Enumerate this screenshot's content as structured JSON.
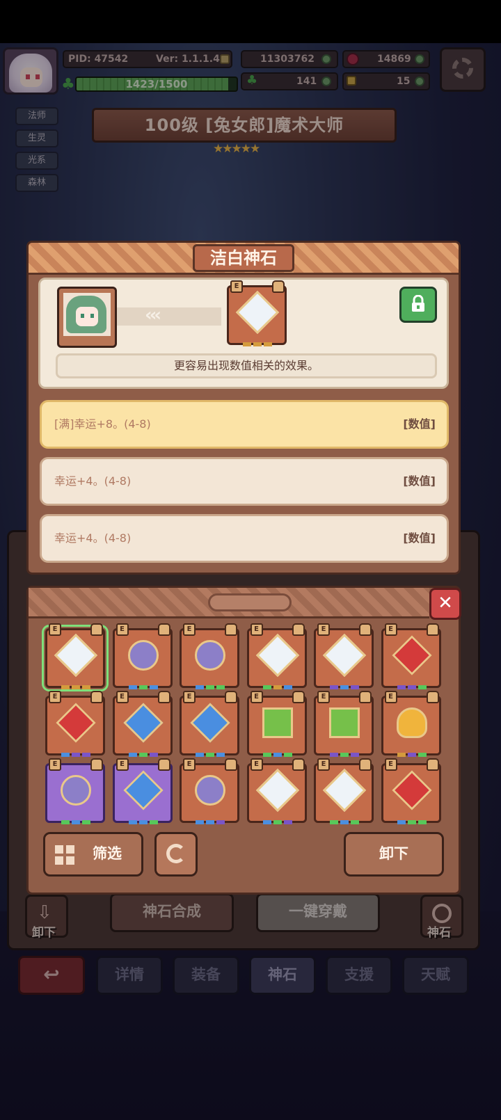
{
  "status": {
    "pid_label": "PID: 47542",
    "version_label": "Ver: 1.1.1.4",
    "gold": "11303762",
    "gems": "14869",
    "exp_text": "1423/1500",
    "exp_fraction": 0.949,
    "clovers": "141",
    "keys": "15"
  },
  "tags": [
    "法师",
    "生灵",
    "光系",
    "森林"
  ],
  "hero": {
    "title": "100级 [兔女郎]魔术大师",
    "stars": 5
  },
  "gem_detail": {
    "title": "洁白神石",
    "description": "更容易出现数值相关的效果。",
    "effects": [
      {
        "text": "[满]幸运+8。(4-8)",
        "kind": "[数值]",
        "maxed": true
      },
      {
        "text": "幸运+4。(4-8)",
        "kind": "[数值]",
        "maxed": false
      },
      {
        "text": "幸运+4。(4-8)",
        "kind": "[数值]",
        "maxed": false
      }
    ]
  },
  "bag": {
    "close_label": "✕",
    "filter_label": "筛选",
    "unload_label": "卸下",
    "slots": [
      {
        "gem": "white",
        "shape": "diamond",
        "bg": "orange",
        "selected": true,
        "sockets": [
          "#d49b3d",
          "#d49b3d",
          "#d49b3d"
        ]
      },
      {
        "gem": "violet",
        "shape": "round",
        "bg": "orange",
        "selected": false,
        "sockets": [
          "#4b8fe0",
          "#58c85a",
          "#4b8fe0"
        ]
      },
      {
        "gem": "violet",
        "shape": "round",
        "bg": "orange",
        "selected": false,
        "sockets": [
          "#4b8fe0",
          "#58c85a",
          "#58c85a"
        ]
      },
      {
        "gem": "white",
        "shape": "diamond",
        "bg": "orange",
        "selected": false,
        "sockets": [
          "#58c85a",
          "#d49b3d",
          "#4b8fe0"
        ]
      },
      {
        "gem": "white",
        "shape": "diamond",
        "bg": "orange",
        "selected": false,
        "sockets": [
          "#7a55c8",
          "#4b8fe0",
          "#7a55c8"
        ]
      },
      {
        "gem": "red",
        "shape": "square",
        "bg": "orange",
        "selected": false,
        "sockets": [
          "#7a55c8",
          "#7a55c8",
          "#58c85a"
        ]
      },
      {
        "gem": "red",
        "shape": "square",
        "bg": "orange",
        "selected": false,
        "sockets": [
          "#4b8fe0",
          "#7a55c8",
          "#7a55c8"
        ]
      },
      {
        "gem": "blue",
        "shape": "square",
        "bg": "orange",
        "selected": false,
        "sockets": [
          "#4b8fe0",
          "#58c85a",
          "#7a55c8"
        ]
      },
      {
        "gem": "blue",
        "shape": "square",
        "bg": "orange",
        "selected": false,
        "sockets": [
          "#4b8fe0",
          "#58c85a",
          "#4b8fe0"
        ]
      },
      {
        "gem": "green",
        "shape": "star",
        "bg": "orange",
        "selected": false,
        "sockets": [
          "#58c85a",
          "#4b8fe0",
          "#58c85a"
        ]
      },
      {
        "gem": "green",
        "shape": "star",
        "bg": "orange",
        "selected": false,
        "sockets": [
          "#7a55c8",
          "#58c85a",
          "#7a55c8"
        ]
      },
      {
        "gem": "gold",
        "shape": "heart",
        "bg": "orange",
        "selected": false,
        "sockets": [
          "#d49b3d",
          "#7a55c8",
          "#58c85a"
        ]
      },
      {
        "gem": "violet",
        "shape": "round",
        "bg": "purple",
        "selected": false,
        "sockets": [
          "#58c85a",
          "#4b8fe0",
          "#58c85a"
        ]
      },
      {
        "gem": "blue",
        "shape": "square",
        "bg": "purple",
        "selected": false,
        "sockets": [
          "#4b8fe0",
          "#4b8fe0",
          "#58c85a"
        ]
      },
      {
        "gem": "violet",
        "shape": "round",
        "bg": "orange",
        "selected": false,
        "sockets": [
          "#4b8fe0",
          "#4b8fe0",
          "#7a55c8"
        ]
      },
      {
        "gem": "white",
        "shape": "diamond",
        "bg": "orange",
        "selected": false,
        "sockets": [
          "#4b8fe0",
          "#58c85a",
          "#7a55c8"
        ]
      },
      {
        "gem": "white",
        "shape": "diamond",
        "bg": "orange",
        "selected": false,
        "sockets": [
          "#58c85a",
          "#4b8fe0",
          "#58c85a"
        ]
      },
      {
        "gem": "red",
        "shape": "square",
        "bg": "orange",
        "selected": false,
        "sockets": [
          "#4b8fe0",
          "#58c85a",
          "#58c85a"
        ]
      }
    ],
    "gem_colors": {
      "white": "#eef3f8",
      "violet": "#8c7fc8",
      "red": "#d43a3a",
      "blue": "#4a8ee0",
      "green": "#76c04a",
      "gold": "#f0b43c"
    }
  },
  "page": {
    "synth_label": "神石合成",
    "one_click_label": "一键穿戴",
    "left_side_label": "卸下",
    "right_side_label": "神石",
    "tabs": [
      "详情",
      "装备",
      "神石",
      "支援",
      "天赋"
    ],
    "active_tab": "神石",
    "back_icon": "back-arrow-icon"
  },
  "colors": {
    "accent_orange": "#c46c4a",
    "maxed_effect_bg": "#fbe3a6",
    "lock_green": "#4fae5c",
    "close_red": "#d04a4a"
  }
}
